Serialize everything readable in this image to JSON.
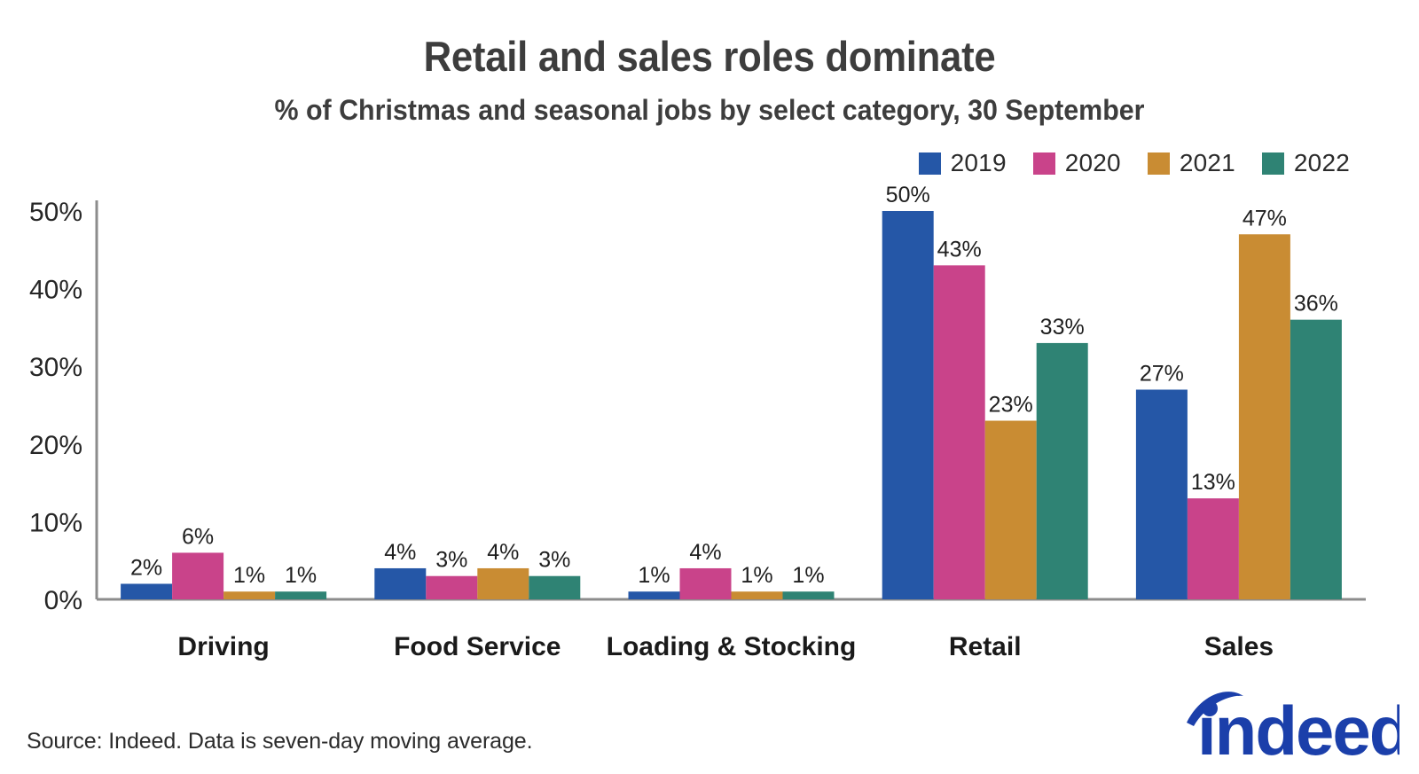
{
  "header": {
    "title": "Retail and sales roles dominate",
    "subtitle": "% of Christmas and seasonal jobs by select category, 30 September"
  },
  "footer": {
    "source": "Source: Indeed. Data is seven-day moving average.",
    "logo_text": "indeed",
    "logo_color": "#1b3faa"
  },
  "chart_data": {
    "type": "bar",
    "title": "Retail and sales roles dominate",
    "subtitle": "% of Christmas and seasonal jobs by select category, 30 September",
    "xlabel": "",
    "ylabel": "",
    "ylim": [
      0,
      50
    ],
    "yticks": [
      0,
      10,
      20,
      30,
      40,
      50
    ],
    "ytick_labels": [
      "0%",
      "10%",
      "20%",
      "30%",
      "40%",
      "50%"
    ],
    "grid": false,
    "legend_position": "top-right",
    "value_format": "{v}%",
    "categories": [
      "Driving",
      "Food Service",
      "Loading & Stocking",
      "Retail",
      "Sales"
    ],
    "series": [
      {
        "name": "2019",
        "color": "#2557a7",
        "values": [
          2,
          4,
          1,
          50,
          27
        ],
        "labels": [
          "2%",
          "4%",
          "1%",
          "50%",
          "27%"
        ]
      },
      {
        "name": "2020",
        "color": "#c9438a",
        "values": [
          6,
          3,
          4,
          43,
          13
        ],
        "labels": [
          "6%",
          "3%",
          "4%",
          "43%",
          "13%"
        ]
      },
      {
        "name": "2021",
        "color": "#c98c33",
        "values": [
          1,
          4,
          1,
          23,
          47
        ],
        "labels": [
          "1%",
          "4%",
          "1%",
          "23%",
          "47%"
        ]
      },
      {
        "name": "2022",
        "color": "#2f8374",
        "values": [
          1,
          3,
          1,
          33,
          36
        ],
        "labels": [
          "1%",
          "3%",
          "1%",
          "33%",
          "36%"
        ]
      }
    ]
  }
}
